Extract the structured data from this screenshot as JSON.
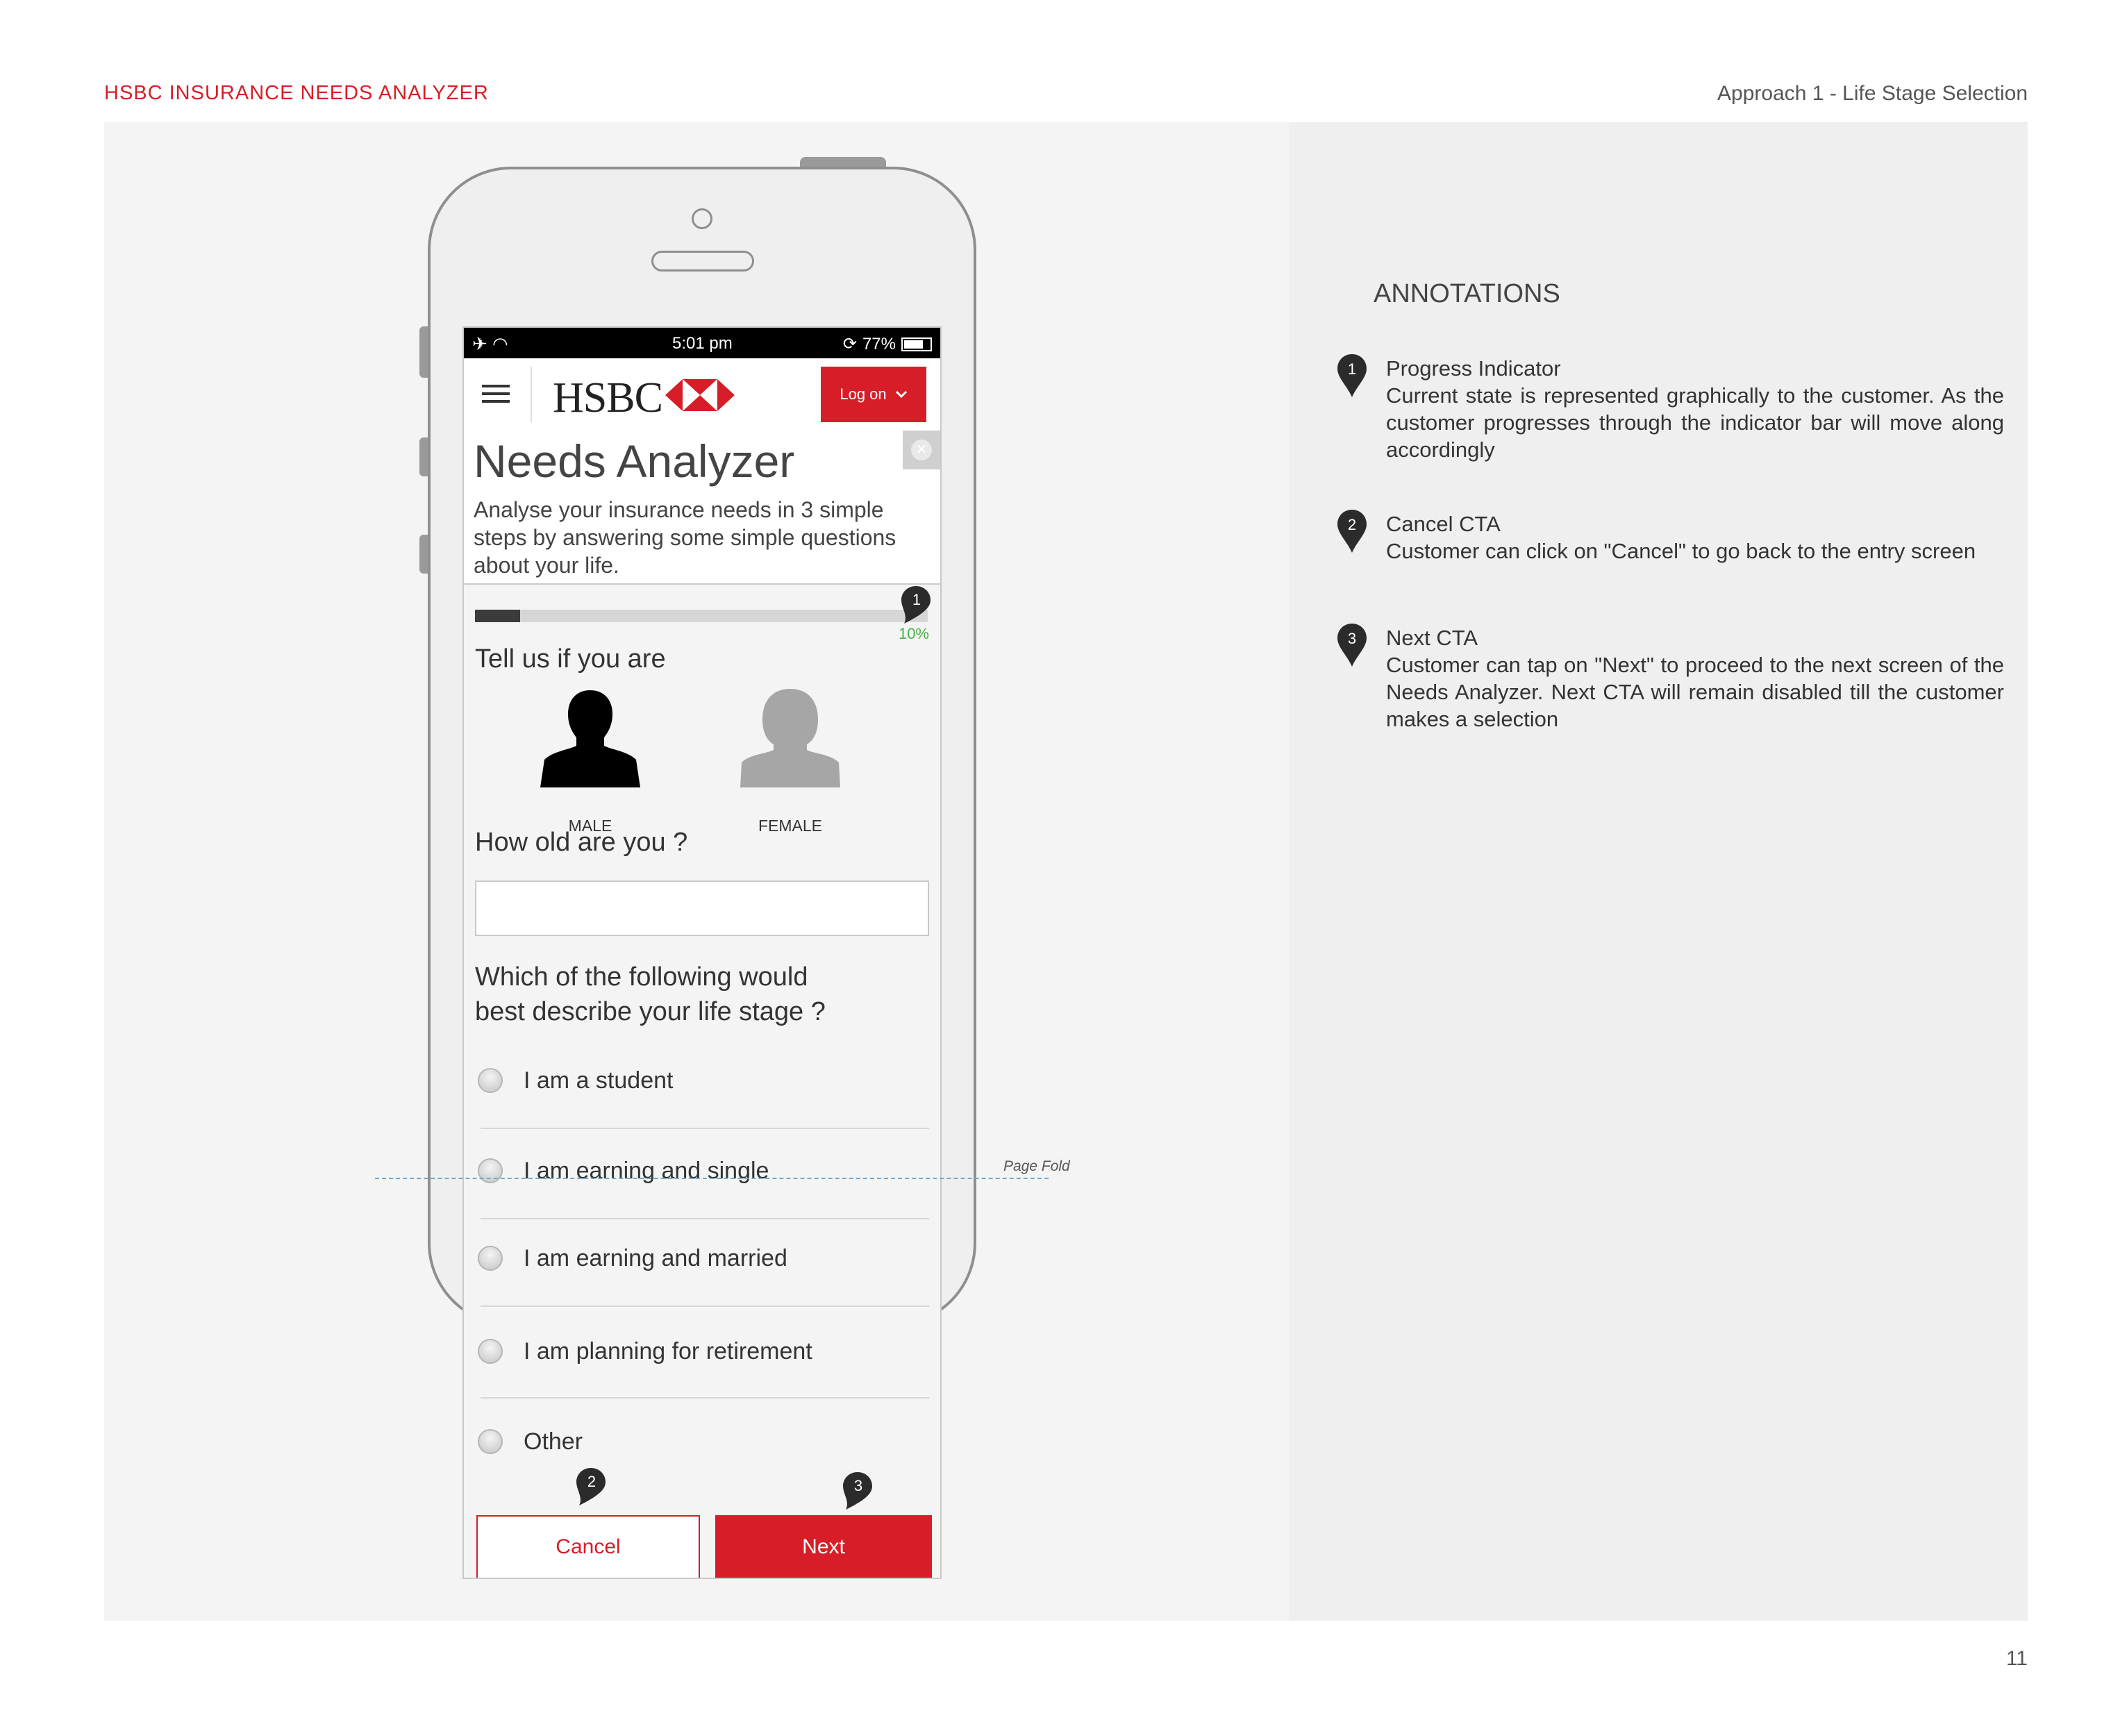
{
  "document": {
    "title": "HSBC INSURANCE NEEDS ANALYZER",
    "subtitle": "Approach 1 - Life Stage Selection",
    "page_number": "11"
  },
  "status_bar": {
    "time": "5:01 pm",
    "battery": "77%",
    "battery_level": 0.77
  },
  "nav": {
    "brand": "HSBC",
    "logon_label": "Log on"
  },
  "screen": {
    "title": "Needs Analyzer",
    "description": "Analyse your insurance needs in 3 simple steps by answering some simple questions about your life.",
    "progress_percent_label": "10%",
    "progress_value": 0.1,
    "gender_question": "Tell us if you are",
    "gender_options": [
      "MALE",
      "FEMALE"
    ],
    "age_question": "How old are you ?",
    "age_value": "",
    "life_stage_question_line1": "Which of the following would",
    "life_stage_question_line2": "best describe your life stage ?",
    "life_stage_options": [
      "I am a student",
      "I am earning and single",
      "I am earning and married",
      "I am planning for retirement",
      "Other"
    ],
    "cancel_label": "Cancel",
    "next_label": "Next"
  },
  "page_fold_label": "Page Fold",
  "annotations": {
    "heading": "ANNOTATIONS",
    "items": [
      {
        "num": "1",
        "title": "Progress Indicator",
        "text": "Current state is represented graphically to the customer. As the customer progresses through the indicator bar will move along accordingly"
      },
      {
        "num": "2",
        "title": "Cancel CTA",
        "text": "Customer can click on \"Cancel\" to go back to the entry screen"
      },
      {
        "num": "3",
        "title": "Next CTA",
        "text": "Customer can tap on \"Next\" to proceed to the next screen of the Needs Analyzer. Next CTA will remain disabled till the customer makes a selection"
      }
    ]
  },
  "colors": {
    "brand_red": "#d71e28",
    "progress_green": "#49b04a",
    "pin_dark": "#2b2b2b"
  }
}
